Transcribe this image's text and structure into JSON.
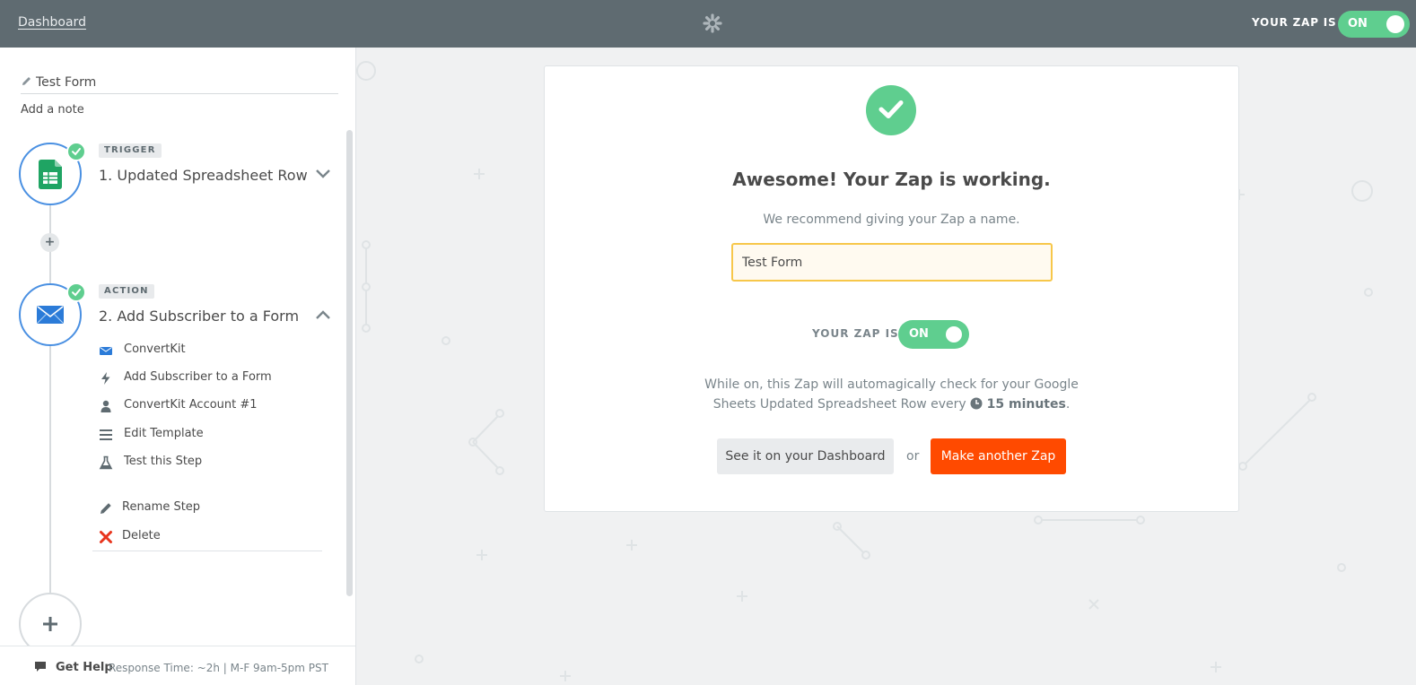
{
  "topbar": {
    "dashboard_link": "Dashboard",
    "zap_status_label": "YOUR ZAP IS",
    "toggle_label": "ON"
  },
  "sidebar": {
    "zap_name": "Test Form",
    "add_note": "Add a note",
    "steps": [
      {
        "tag": "TRIGGER",
        "title": "1. Updated Spreadsheet Row",
        "app_icon": "google-sheets-icon",
        "status": "complete",
        "expanded": false
      },
      {
        "tag": "ACTION",
        "title": "2. Add Subscriber to a Form",
        "app_icon": "convertkit-icon",
        "status": "complete",
        "expanded": true,
        "details": [
          {
            "icon": "convertkit-icon",
            "label": "ConvertKit"
          },
          {
            "icon": "bolt-icon",
            "label": "Add Subscriber to a Form"
          },
          {
            "icon": "user-icon",
            "label": "ConvertKit Account #1"
          },
          {
            "icon": "list-icon",
            "label": "Edit Template"
          },
          {
            "icon": "flask-icon",
            "label": "Test this Step"
          }
        ],
        "actions": [
          {
            "icon": "pencil-icon",
            "label": "Rename Step"
          },
          {
            "icon": "delete-x-icon",
            "label": "Delete"
          }
        ]
      }
    ]
  },
  "help": {
    "get_help": "Get Help",
    "response_time": "Response Time: ~2h | M-F 9am-5pm PST"
  },
  "card": {
    "headline": "Awesome! Your Zap is working.",
    "recommend": "We recommend giving your Zap a name.",
    "name_value": "Test Form",
    "zap_status_label": "YOUR ZAP IS",
    "toggle_label": "ON",
    "description_line1": "While on, this Zap will automagically check for your Google",
    "description_line2_prefix": "Sheets Updated Spreadsheet Row every",
    "interval": "15 minutes",
    "description_suffix": ".",
    "dashboard_button": "See it on your Dashboard",
    "or_text": "or",
    "make_button": "Make another Zap"
  },
  "colors": {
    "topbar": "#5f6b71",
    "success_green": "#5fce8f",
    "brand_orange": "#ff4a00",
    "step_blue": "#4a90e2",
    "input_highlight": "#f7c74a"
  }
}
